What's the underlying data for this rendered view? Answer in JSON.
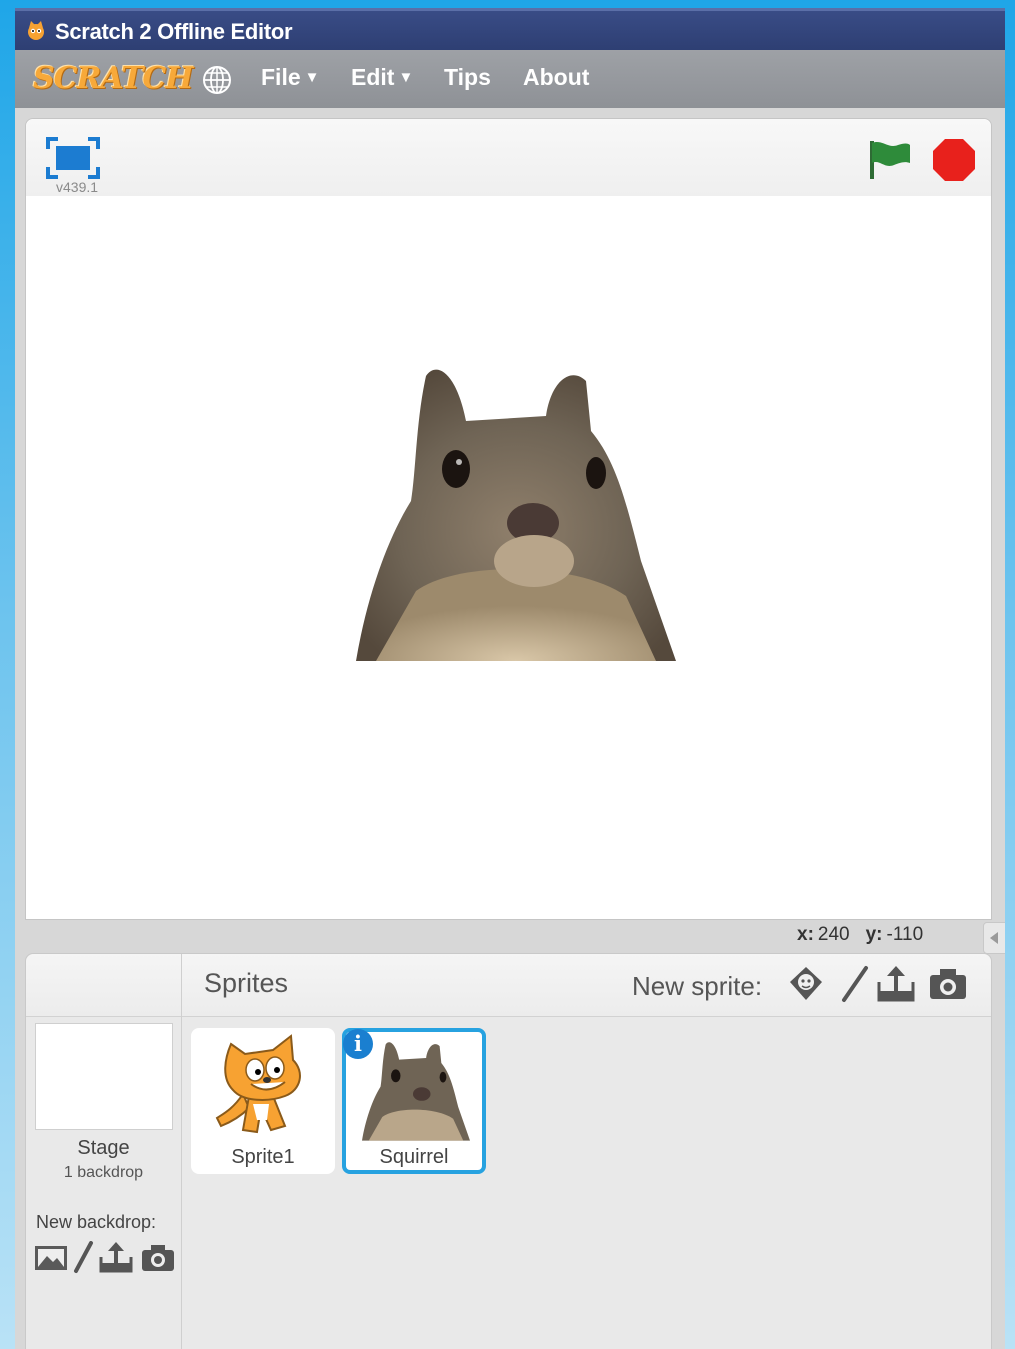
{
  "window": {
    "title": "Scratch 2 Offline Editor"
  },
  "menubar": {
    "logo": "SCRATCH",
    "items": [
      {
        "label": "File",
        "has_caret": true
      },
      {
        "label": "Edit",
        "has_caret": true
      },
      {
        "label": "Tips",
        "has_caret": false
      },
      {
        "label": "About",
        "has_caret": false
      }
    ],
    "caret": "▼"
  },
  "stage": {
    "version": "v439.1"
  },
  "coords": {
    "x_label": "x:",
    "x_value": "240",
    "y_label": "y:",
    "y_value": "-110"
  },
  "sprites_pane": {
    "title": "Sprites",
    "new_sprite_label": "New sprite:",
    "stage": {
      "label": "Stage",
      "sub": "1 backdrop",
      "new_backdrop_label": "New backdrop:"
    },
    "sprites": [
      {
        "name": "Sprite1",
        "selected": false
      },
      {
        "name": "Squirrel",
        "selected": true
      }
    ],
    "info_badge": "i"
  },
  "colors": {
    "accent": "#27a2e0",
    "title_bar": "#2e3f73",
    "menu_bar": "#95989d",
    "stop": "#e8211c",
    "flag": "#2e8b3a"
  }
}
